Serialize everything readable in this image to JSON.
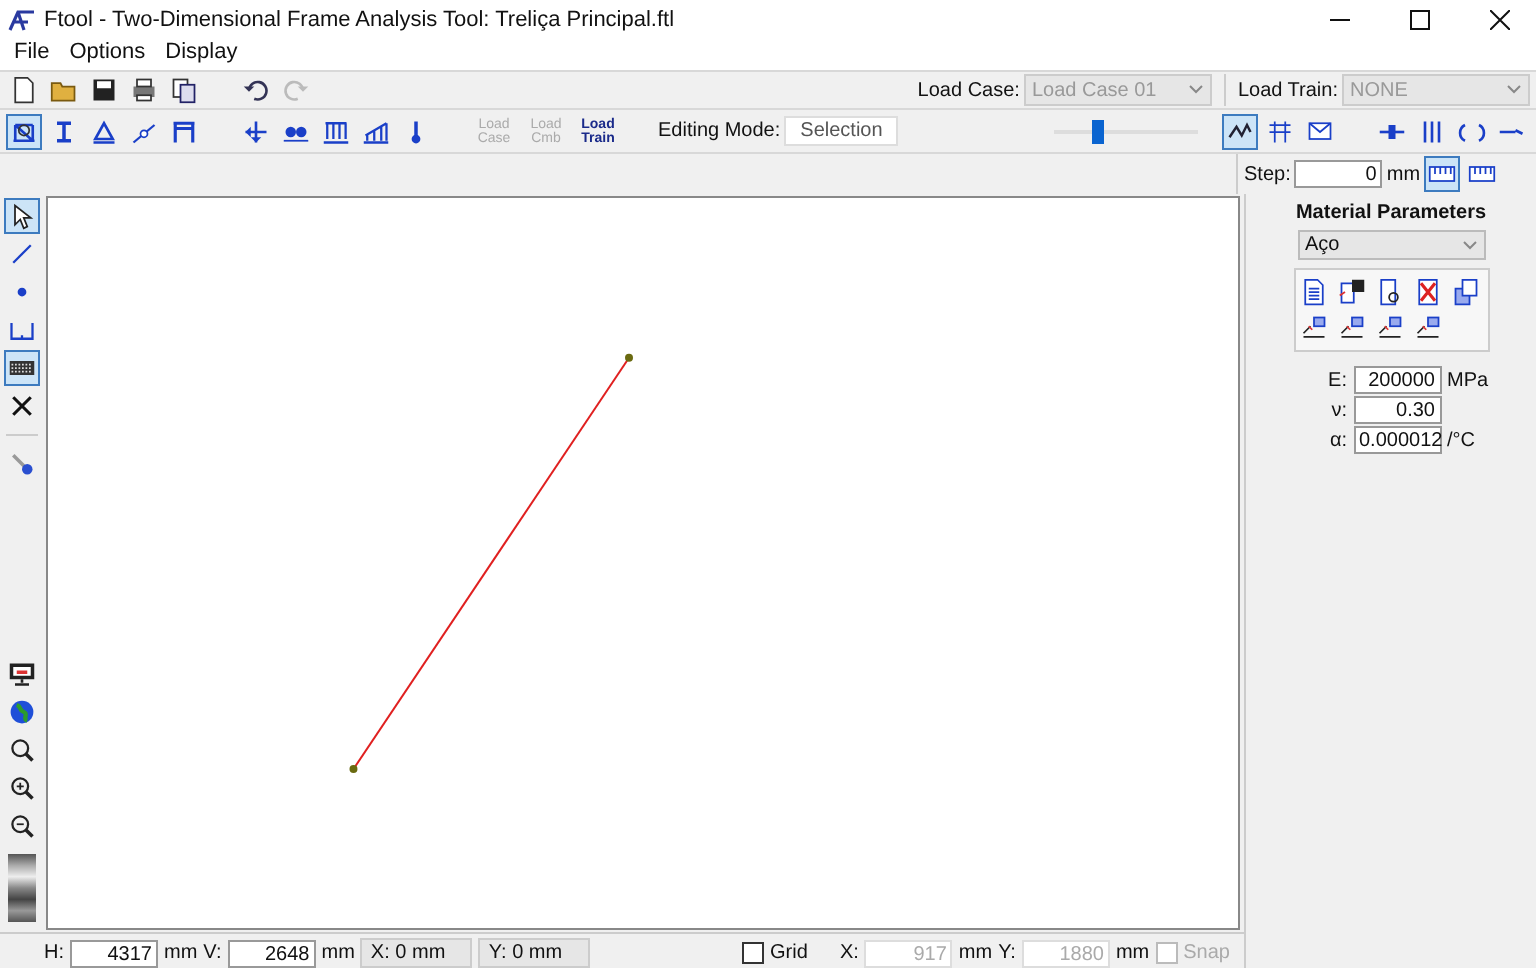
{
  "window": {
    "title": "Ftool - Two-Dimensional Frame Analysis Tool: Treliça Principal.ftl"
  },
  "menu": [
    "File",
    "Options",
    "Display"
  ],
  "toolbar": {
    "load_case": {
      "label": "Load Case:",
      "value": "Load Case 01",
      "disabled": true
    },
    "load_train": {
      "label": "Load Train:",
      "value": "NONE",
      "disabled": true
    }
  },
  "mode_tools": [
    {
      "selected": true
    },
    {
      "selected": false
    },
    {
      "selected": false
    },
    {
      "selected": false
    },
    {
      "selected": false
    }
  ],
  "load_buttons": [
    {
      "label": "Load Case",
      "disabled": true
    },
    {
      "label": "Load Cmb",
      "disabled": true
    },
    {
      "label": "Load Train",
      "disabled": false
    }
  ],
  "editing_mode": {
    "label": "Editing Mode:",
    "value": "Selection"
  },
  "scale_slider": {
    "level": 0.3
  },
  "result_tools": [
    {
      "selected": true
    },
    {
      "selected": false
    },
    {
      "selected": false
    }
  ],
  "step": {
    "label": "Step:",
    "value": "0",
    "unit": "mm",
    "options": [
      {
        "selected": true
      },
      {
        "selected": false
      }
    ]
  },
  "left_tools": [
    {
      "selected": true
    },
    {
      "selected": false
    },
    {
      "selected": false
    },
    {
      "selected": false
    },
    {
      "selected": true
    },
    {
      "selected": false
    }
  ],
  "material": {
    "title": "Material Parameters",
    "value": "Aço",
    "params": [
      {
        "label": "E:",
        "value": "200000",
        "unit": "MPa"
      },
      {
        "label": "ν:",
        "value": "0.30"
      },
      {
        "label": "α:",
        "value": "0.000012",
        "unit": "/°C"
      }
    ]
  },
  "status_bar": {
    "h_label": "H:",
    "h_value": "4317",
    "h_unit": "mm",
    "v_label": "V:",
    "v_value": "2648",
    "v_unit": "mm",
    "x_readout": "X: 0 mm",
    "y_readout": "Y: 0 mm",
    "grid": {
      "label": "Grid",
      "checked": false
    },
    "x_label": "X:",
    "x_value": "917",
    "x_unit": "mm",
    "y_label": "Y:",
    "y_value": "1880",
    "y_unit": "mm",
    "snap": {
      "label": "Snap",
      "checked": false,
      "disabled": true
    }
  }
}
